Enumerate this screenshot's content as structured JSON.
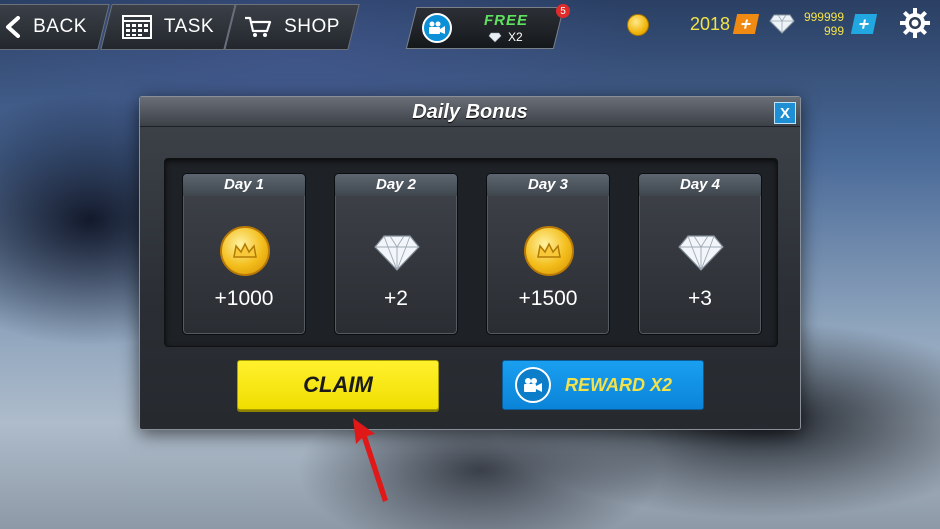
{
  "topbar": {
    "back_label": "BACK",
    "task_label": "TASK",
    "shop_label": "SHOP",
    "free_label": "FREE",
    "free_multiplier": "X2",
    "notification_count": "5",
    "coins": "2018",
    "gems_line1": "999999",
    "gems_line2": "999"
  },
  "dialog": {
    "title": "Daily Bonus",
    "close_label": "X",
    "days": [
      {
        "label": "Day 1",
        "amount": "+1000",
        "icon": "coin-icon"
      },
      {
        "label": "Day 2",
        "amount": "+2",
        "icon": "diamond-icon"
      },
      {
        "label": "Day 3",
        "amount": "+1500",
        "icon": "coin-icon"
      },
      {
        "label": "Day 4",
        "amount": "+3",
        "icon": "diamond-icon"
      }
    ],
    "claim_label": "CLAIM",
    "reward_label": "REWARD X2"
  },
  "colors": {
    "claim": "#f3e300",
    "reward": "#1592e6",
    "accent_text": "#f2e24a",
    "free_text": "#5fe35f"
  }
}
